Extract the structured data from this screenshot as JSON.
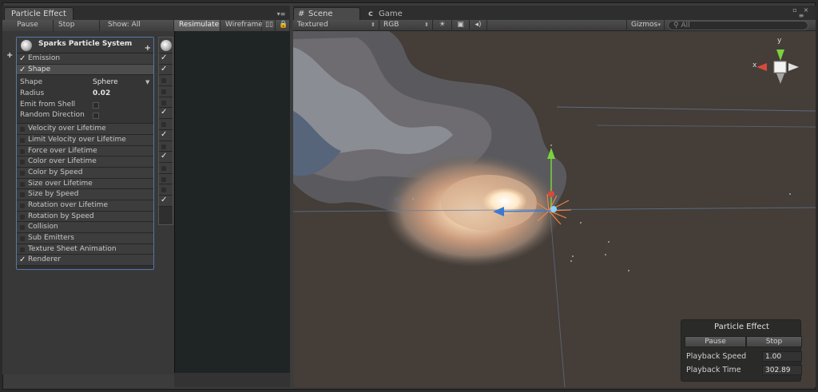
{
  "left_panel": {
    "tab_title": "Particle Effect",
    "toolbar": {
      "pause": "Pause",
      "stop": "Stop",
      "show": "Show: All",
      "resimulate": "Resimulate",
      "wireframe": "Wireframe"
    },
    "particle_system": {
      "title": "Sparks Particle System",
      "modules_top": [
        {
          "label": "Emission",
          "enabled": true
        },
        {
          "label": "Shape",
          "enabled": true
        }
      ],
      "shape_props": {
        "shape_label": "Shape",
        "shape_value": "Sphere",
        "radius_label": "Radius",
        "radius_value": "0.02",
        "emit_label": "Emit from Shell",
        "random_label": "Random Direction"
      },
      "modules": [
        {
          "label": "Velocity over Lifetime",
          "enabled": false
        },
        {
          "label": "Limit Velocity over Lifetime",
          "enabled": false
        },
        {
          "label": "Force over Lifetime",
          "enabled": false
        },
        {
          "label": "Color over Lifetime",
          "enabled": false
        },
        {
          "label": "Color by Speed",
          "enabled": false
        },
        {
          "label": "Size over Lifetime",
          "enabled": false
        },
        {
          "label": "Size by Speed",
          "enabled": false
        },
        {
          "label": "Rotation over Lifetime",
          "enabled": false
        },
        {
          "label": "Rotation by Speed",
          "enabled": false
        },
        {
          "label": "Collision",
          "enabled": false
        },
        {
          "label": "Sub Emitters",
          "enabled": false
        },
        {
          "label": "Texture Sheet Animation",
          "enabled": false
        },
        {
          "label": "Renderer",
          "enabled": true
        }
      ]
    }
  },
  "right_panel": {
    "tabs": {
      "scene": "Scene",
      "game": "Game"
    },
    "toolbar": {
      "render_mode": "Textured",
      "color_mode": "RGB",
      "gizmos": "Gizmos",
      "search_placeholder": "All"
    },
    "axes": {
      "x": "x",
      "y": "y"
    },
    "overlay": {
      "title": "Particle Effect",
      "pause": "Pause",
      "stop": "Stop",
      "playback_speed_label": "Playback Speed",
      "playback_speed": "1.00",
      "playback_time_label": "Playback Time",
      "playback_time": "302.89"
    }
  }
}
